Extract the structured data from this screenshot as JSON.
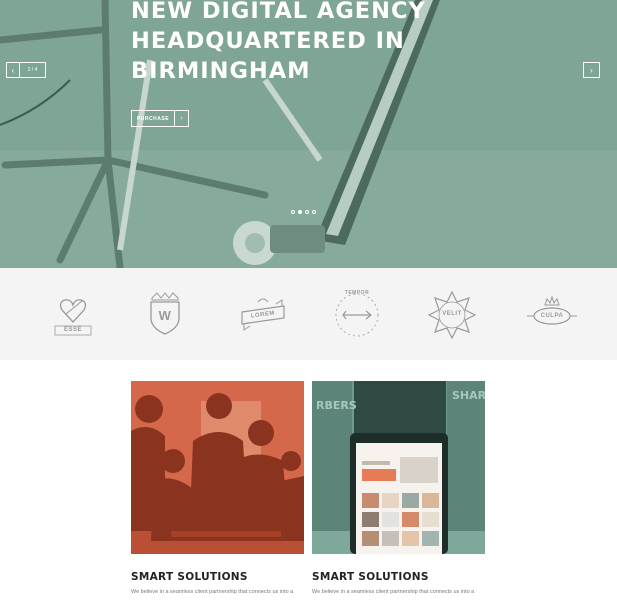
{
  "hero": {
    "title_lines": [
      "NEW DIGITAL AGENCY",
      "HEADQUARTERED IN",
      "BIRMINGHAM"
    ],
    "purchase_label": "PURCHASE",
    "purchase_arrow": "›",
    "prev_arrow": "‹",
    "next_arrow": "›",
    "slide_counter": "2 / 4",
    "dot_count": 4,
    "active_dot": 2,
    "overlay_color": "#7fa595"
  },
  "logos": [
    {
      "name": "ESSE",
      "icon": "heart-arrow-icon"
    },
    {
      "name": "W",
      "icon": "crown-shield-icon"
    },
    {
      "name": "LOREM",
      "icon": "ribbon-banner-icon"
    },
    {
      "name": "TEMPOR",
      "icon": "arrow-circle-icon"
    },
    {
      "name": "VELIT",
      "icon": "star-badge-icon"
    },
    {
      "name": "CULPA",
      "icon": "crown-laurel-icon"
    }
  ],
  "cards": [
    {
      "title": "SMART SOLUTIONS",
      "text": "We believe in a seamless client partnership that connects us into a",
      "tint": "#d5684a"
    },
    {
      "title": "SMART SOLUTIONS",
      "text": "We believe in a seamless client partnership that connects us into a",
      "tint": "#6f9a8f"
    }
  ]
}
